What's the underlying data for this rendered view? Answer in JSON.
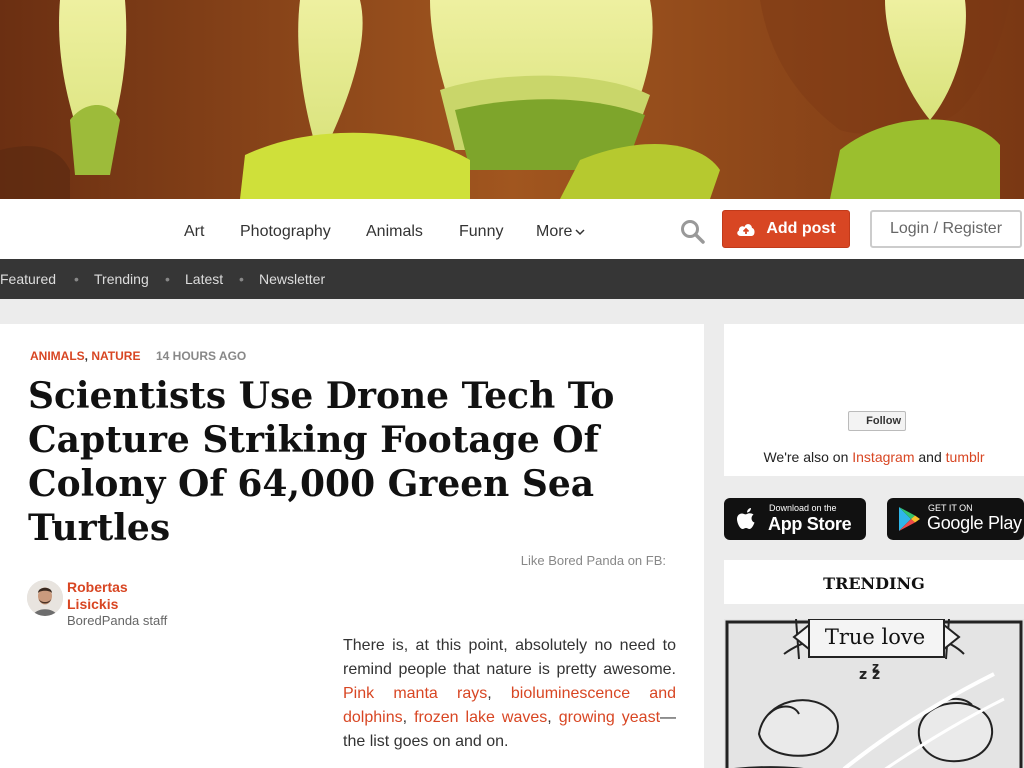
{
  "nav": {
    "items": [
      "Art",
      "Photography",
      "Animals",
      "Funny",
      "More"
    ],
    "add_post": "Add post",
    "login": "Login / Register"
  },
  "subnav": {
    "items": [
      "Featured",
      "Trending",
      "Latest",
      "Newsletter"
    ]
  },
  "article": {
    "categories": [
      "ANIMALS",
      "NATURE"
    ],
    "category_separator": ",",
    "time": "14 HOURS AGO",
    "title": "Scientists Use Drone Tech To Capture Striking Footage Of Colony Of 64,000 Green Sea Turtles",
    "like_fb": "Like Bored Panda on FB:",
    "author_name": "Robertas Lisickis",
    "author_role": "BoredPanda staff",
    "body": {
      "intro": "There is, at this point, absolutely no need to remind people that nature is pretty awesome.",
      "link1": "Pink manta rays",
      "sep1": ",",
      "link2": "bioluminescence and dolphins",
      "sep2": ",",
      "link3": "frozen lake waves",
      "sep3": ",",
      "link4": "growing yeast",
      "outro": "—the list goes on and on."
    }
  },
  "sidebar": {
    "follow": "Follow",
    "also_text": "We're also on",
    "instagram": "Instagram",
    "and": "and",
    "tumblr": "tumblr",
    "appstore_small": "Download on the",
    "appstore_big": "App Store",
    "gplay_small": "GET IT ON",
    "gplay_big": "Google Play",
    "trending": "TRENDING",
    "comic_label": "True love"
  },
  "colors": {
    "accent": "#d84623",
    "subnav_bg": "#363636",
    "page_bg": "#ececec"
  }
}
